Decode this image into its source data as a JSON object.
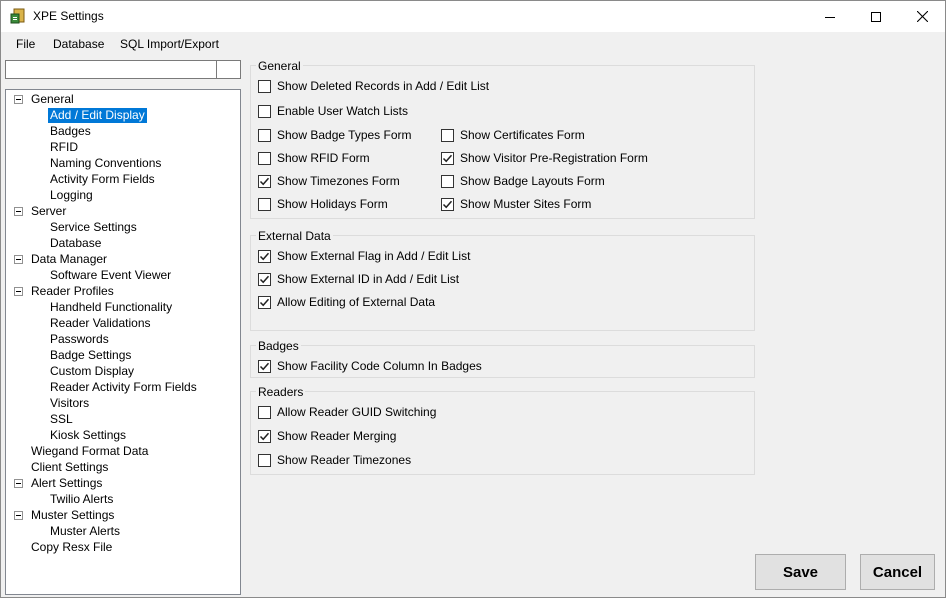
{
  "window": {
    "title": "XPE Settings"
  },
  "menu": {
    "items": [
      "File",
      "Database",
      "SQL Import/Export"
    ]
  },
  "tree": {
    "nodes": [
      {
        "label": "General",
        "level": 0,
        "expanded": true
      },
      {
        "label": "Add / Edit Display",
        "level": 1,
        "selected": true
      },
      {
        "label": "Badges",
        "level": 1
      },
      {
        "label": "RFID",
        "level": 1
      },
      {
        "label": "Naming Conventions",
        "level": 1
      },
      {
        "label": "Activity Form Fields",
        "level": 1
      },
      {
        "label": "Logging",
        "level": 1
      },
      {
        "label": "Server",
        "level": 0,
        "expanded": true
      },
      {
        "label": "Service Settings",
        "level": 1
      },
      {
        "label": "Database",
        "level": 1
      },
      {
        "label": "Data Manager",
        "level": 0,
        "expanded": true
      },
      {
        "label": "Software Event Viewer",
        "level": 1
      },
      {
        "label": "Reader Profiles",
        "level": 0,
        "expanded": true
      },
      {
        "label": "Handheld Functionality",
        "level": 1
      },
      {
        "label": "Reader Validations",
        "level": 1
      },
      {
        "label": "Passwords",
        "level": 1
      },
      {
        "label": "Badge Settings",
        "level": 1
      },
      {
        "label": "Custom Display",
        "level": 1
      },
      {
        "label": "Reader Activity Form Fields",
        "level": 1
      },
      {
        "label": "Visitors",
        "level": 1
      },
      {
        "label": "SSL",
        "level": 1
      },
      {
        "label": "Kiosk Settings",
        "level": 1
      },
      {
        "label": "Wiegand Format Data",
        "level": 0
      },
      {
        "label": "Client Settings",
        "level": 0
      },
      {
        "label": "Alert Settings",
        "level": 0,
        "expanded": true
      },
      {
        "label": "Twilio Alerts",
        "level": 1
      },
      {
        "label": "Muster Settings",
        "level": 0,
        "expanded": true
      },
      {
        "label": "Muster Alerts",
        "level": 1
      },
      {
        "label": "Copy Resx File",
        "level": 0
      }
    ]
  },
  "groups": {
    "general": {
      "title": "General",
      "items": [
        {
          "label": "Show Deleted Records in Add / Edit List",
          "checked": false
        },
        {
          "label": "Enable User Watch Lists",
          "checked": false
        },
        {
          "label": "Show Badge Types Form",
          "checked": false
        },
        {
          "label": "Show Certificates Form",
          "checked": false
        },
        {
          "label": "Show RFID Form",
          "checked": false
        },
        {
          "label": "Show Visitor Pre-Registration Form",
          "checked": true
        },
        {
          "label": "Show Timezones Form",
          "checked": true
        },
        {
          "label": "Show Badge Layouts Form",
          "checked": false
        },
        {
          "label": "Show Holidays Form",
          "checked": false
        },
        {
          "label": "Show Muster Sites Form",
          "checked": true
        }
      ]
    },
    "external": {
      "title": "External Data",
      "items": [
        {
          "label": "Show External Flag in Add / Edit List",
          "checked": true
        },
        {
          "label": "Show External ID in Add / Edit List",
          "checked": true
        },
        {
          "label": "Allow Editing of External Data",
          "checked": true
        }
      ]
    },
    "badges": {
      "title": "Badges",
      "items": [
        {
          "label": "Show Facility Code Column In Badges",
          "checked": true
        }
      ]
    },
    "readers": {
      "title": "Readers",
      "items": [
        {
          "label": "Allow Reader GUID Switching",
          "checked": false
        },
        {
          "label": "Show Reader Merging",
          "checked": true
        },
        {
          "label": "Show Reader Timezones",
          "checked": false
        }
      ]
    }
  },
  "buttons": {
    "save": "Save",
    "cancel": "Cancel"
  }
}
